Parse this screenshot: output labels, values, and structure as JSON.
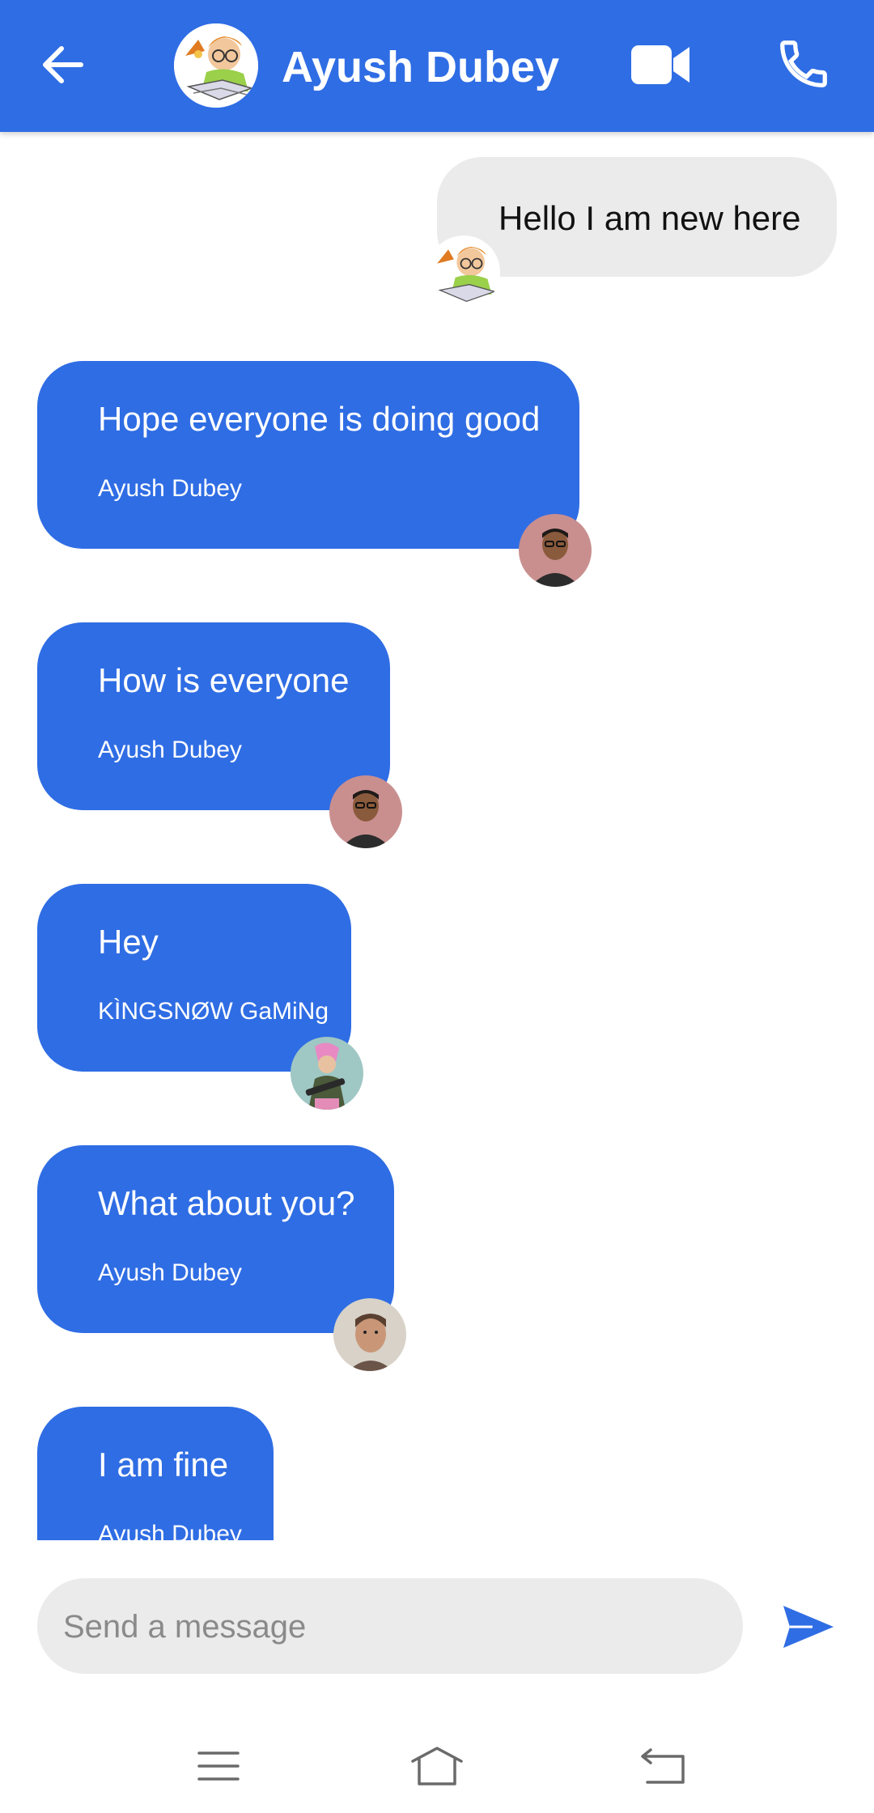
{
  "header": {
    "title": "Ayush Dubey",
    "avatar_icon": "cartoon-reader-avatar",
    "colors": {
      "bar": "#2f6de4",
      "text": "#ffffff"
    }
  },
  "messages": [
    {
      "direction": "outgoing",
      "text": "Hello I am new here",
      "avatar_icon": "cartoon-reader-avatar"
    },
    {
      "direction": "incoming",
      "text": "Hope everyone is doing good",
      "sender": "Ayush Dubey",
      "avatar_icon": "man-photo-avatar"
    },
    {
      "direction": "incoming",
      "text": "How is everyone",
      "sender": "Ayush Dubey",
      "avatar_icon": "man-photo-avatar"
    },
    {
      "direction": "incoming",
      "text": "Hey",
      "sender": "KÌNGSNØW GaMiNg",
      "avatar_icon": "gamer-character-avatar"
    },
    {
      "direction": "incoming",
      "text": "What about you?",
      "sender": "Ayush Dubey",
      "avatar_icon": "actor-photo-avatar"
    },
    {
      "direction": "incoming",
      "text": "I am fine",
      "sender": "Ayush Dubey",
      "avatar_icon": "man-photo-avatar"
    }
  ],
  "composer": {
    "placeholder": "Send a message",
    "value": ""
  },
  "colors": {
    "accent": "#2f6de4",
    "outgoing_bubble": "#ebebeb",
    "incoming_bubble": "#2f6de4"
  },
  "icons": {
    "back": "arrow-left-icon",
    "video": "video-camera-icon",
    "call": "phone-icon",
    "send": "send-icon",
    "nav_menu": "menu-icon",
    "nav_home": "home-icon",
    "nav_back": "back-nav-icon"
  }
}
